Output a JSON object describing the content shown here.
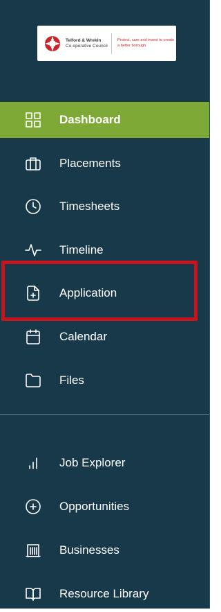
{
  "logo": {
    "org_line1": "Telford & Wrekin",
    "org_line2": "Co-operative Council",
    "tagline": "Protect, care and invest to create a better borough"
  },
  "nav_items": [
    {
      "label": "Dashboard",
      "icon": "grid-icon",
      "active": true
    },
    {
      "label": "Placements",
      "icon": "briefcase-icon"
    },
    {
      "label": "Timesheets",
      "icon": "clock-icon"
    },
    {
      "label": "Timeline",
      "icon": "activity-icon"
    },
    {
      "label": "Application",
      "icon": "file-plus-icon"
    },
    {
      "label": "Calendar",
      "icon": "calendar-icon"
    },
    {
      "label": "Files",
      "icon": "folder-icon"
    }
  ],
  "nav_items_secondary": [
    {
      "label": "Job Explorer",
      "icon": "bar-chart-icon"
    },
    {
      "label": "Opportunities",
      "icon": "plus-circle-icon"
    },
    {
      "label": "Businesses",
      "icon": "building-icon"
    },
    {
      "label": "Resource Library",
      "icon": "book-open-icon"
    }
  ],
  "colors": {
    "sidebar_bg": "#17394a",
    "active_bg": "#7fa936",
    "highlight_border": "#c4161c",
    "logo_tagline": "#c8262d"
  }
}
